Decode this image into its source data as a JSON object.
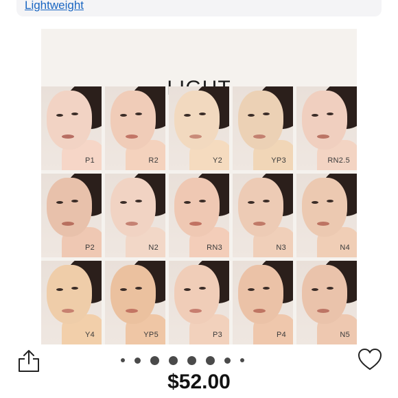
{
  "top_link": {
    "label": "Lightweight"
  },
  "product_image": {
    "title": "LIGHT",
    "shades": [
      {
        "label": "P1",
        "skin": "#f2d3c4",
        "neck": "#f6d6c7",
        "lips": "#b86e63"
      },
      {
        "label": "R2",
        "skin": "#f0ccb8",
        "neck": "#f4d2bd",
        "lips": "#c27566"
      },
      {
        "label": "Y2",
        "skin": "#f2d9bf",
        "neck": "#f5dbbf",
        "lips": "#c98b79"
      },
      {
        "label": "YP3",
        "skin": "#ecd1b5",
        "neck": "#f1d6b7",
        "lips": "#c38170"
      },
      {
        "label": "RN2.5",
        "skin": "#f0cfbf",
        "neck": "#f3d4c3",
        "lips": "#bb7565"
      },
      {
        "label": "P2",
        "skin": "#e8c1ab",
        "neck": "#efc8b3",
        "lips": "#b8705f"
      },
      {
        "label": "N2",
        "skin": "#f1d3c3",
        "neck": "#f2d7c7",
        "lips": "#c58273"
      },
      {
        "label": "RN3",
        "skin": "#efc8b3",
        "neck": "#f3cdb9",
        "lips": "#c17262"
      },
      {
        "label": "N3",
        "skin": "#edcbb5",
        "neck": "#f0cfb9",
        "lips": "#c07a68"
      },
      {
        "label": "N4",
        "skin": "#ecc9b1",
        "neck": "#f0ceb6",
        "lips": "#bd7463"
      },
      {
        "label": "Y4",
        "skin": "#efcda9",
        "neck": "#f2cfaa",
        "lips": "#c78170"
      },
      {
        "label": "YP5",
        "skin": "#ebc19f",
        "neck": "#efc6a5",
        "lips": "#c37563"
      },
      {
        "label": "P3",
        "skin": "#f0cdb8",
        "neck": "#f2d1bc",
        "lips": "#c77e6f"
      },
      {
        "label": "P4",
        "skin": "#ebc2a7",
        "neck": "#efc7ac",
        "lips": "#bf7563"
      },
      {
        "label": "N5",
        "skin": "#eac3ab",
        "neck": "#eec8b0",
        "lips": "#bd7565"
      }
    ]
  },
  "carousel": {
    "dot_count": 8,
    "active_index": 2,
    "icons": {
      "share": "share-icon",
      "favorite": "heart-icon"
    }
  },
  "price": "$52.00",
  "colors": {
    "link": "#1a66c2",
    "background": "#f5f2ee"
  }
}
